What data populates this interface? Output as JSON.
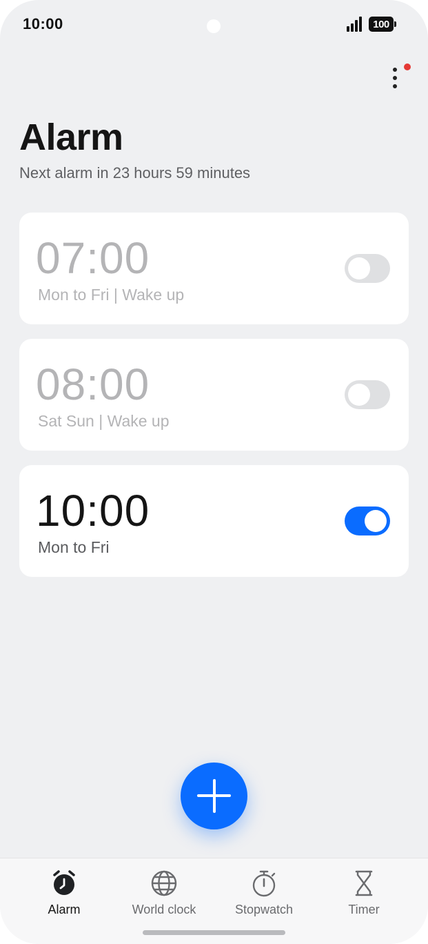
{
  "status_bar": {
    "time": "10:00",
    "battery": "100",
    "icons": [
      "signal-icon",
      "battery-icon"
    ]
  },
  "header": {
    "title": "Alarm",
    "subtitle": "Next alarm in 23 hours 59 minutes",
    "menu_icon": "more-vertical-icon",
    "notification_color": "#e53935"
  },
  "alarms": [
    {
      "time": "07:00",
      "label": "Mon to Fri | Wake up",
      "enabled": false
    },
    {
      "time": "08:00",
      "label": "Sat Sun | Wake up",
      "enabled": false
    },
    {
      "time": "10:00",
      "label": "Mon to Fri",
      "enabled": true
    }
  ],
  "fab": {
    "icon": "plus-icon",
    "color": "#0a6cff"
  },
  "bottom_nav": {
    "items": [
      {
        "label": "Alarm",
        "icon": "alarm-clock-icon",
        "active": true
      },
      {
        "label": "World clock",
        "icon": "globe-icon",
        "active": false
      },
      {
        "label": "Stopwatch",
        "icon": "stopwatch-icon",
        "active": false
      },
      {
        "label": "Timer",
        "icon": "hourglass-icon",
        "active": false
      }
    ]
  },
  "colors": {
    "accent": "#0a6cff",
    "background": "#eff0f2",
    "card": "#ffffff",
    "disabled_text": "#b4b4b6"
  }
}
